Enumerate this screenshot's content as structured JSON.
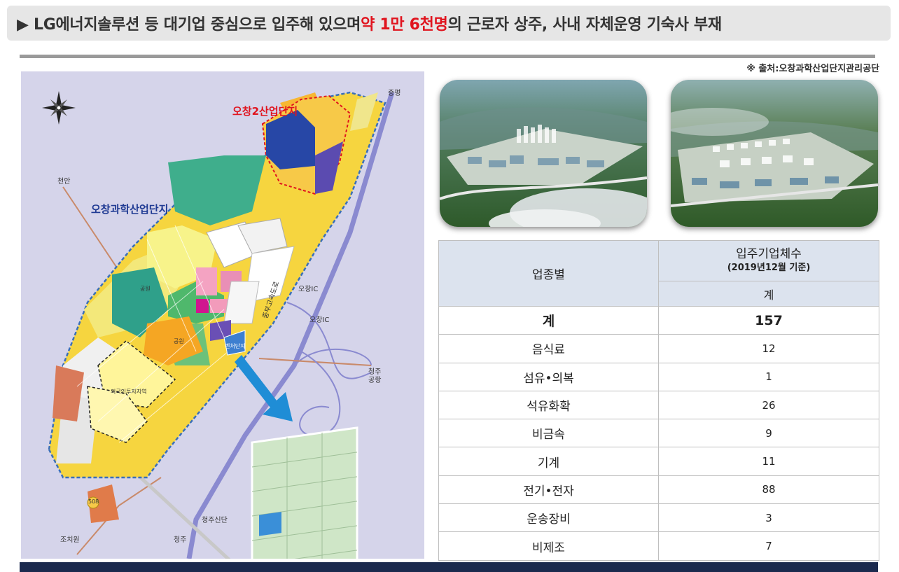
{
  "headline": {
    "prefix": "▶ LG에너지솔루션 등 대기업 중심으로 입주해 있으며 ",
    "highlight": "약 1만 6천명",
    "suffix": "의 근로자 상주, 사내 자체운영 기숙사 부재"
  },
  "source": "※ 출처:오창과학산업단지관리공단",
  "map": {
    "zone_red_label": "오창2산업단지",
    "zone_blue_label": "오창과학산업단지",
    "places": {
      "jeungpyeong": "증평",
      "cheonan": "천안",
      "ochang_ic_1": "오창IC",
      "ochang_ic_2": "오창IC",
      "cheongju_airport_1": "청주",
      "cheongju_airport_2": "공항",
      "cheongju_sindan": "청주신단",
      "cheongju": "청주",
      "jochiwon": "조치원",
      "road_sign": "중부고속도로",
      "route": "508",
      "foreign_zone": "외국인투자지역",
      "park_1": "공원",
      "park_2": "공원",
      "venture": "벤처단지"
    }
  },
  "photos": [
    {
      "alt": "aerial-view-1"
    },
    {
      "alt": "aerial-view-2"
    }
  ],
  "table": {
    "header_industry": "업종별",
    "header_main": "입주기업체수",
    "header_date": "(2019년12월 기준)",
    "header_sub": "계",
    "total": {
      "category": "계",
      "value": "157"
    },
    "rows": [
      {
        "category": "음식료",
        "value": "12"
      },
      {
        "category": "섬유•의복",
        "value": "1"
      },
      {
        "category": "석유화확",
        "value": "26"
      },
      {
        "category": "비금속",
        "value": "9"
      },
      {
        "category": "기계",
        "value": "11"
      },
      {
        "category": "전기•전자",
        "value": "88"
      },
      {
        "category": "운송장비",
        "value": "3"
      },
      {
        "category": "비제조",
        "value": "7"
      }
    ]
  },
  "colors": {
    "highlight_red": "#e0141e",
    "header_fill": "#dce3ee",
    "footer_navy": "#1b2a4e",
    "map_background": "#d5d4ea"
  }
}
